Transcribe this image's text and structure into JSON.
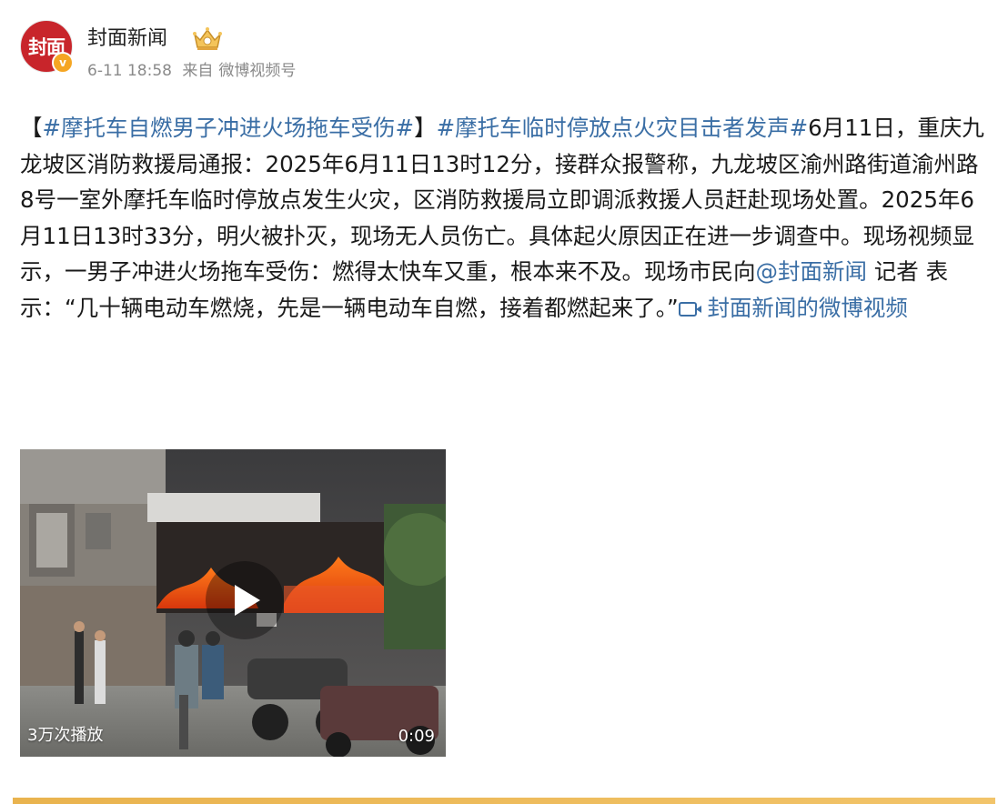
{
  "header": {
    "avatar_text": "封面",
    "avatar_badge": "v",
    "username": "封面新闻",
    "crown_icon": "crown-icon",
    "timestamp": "6-11 18:58",
    "source_prefix": "来自",
    "source": "微博视频号"
  },
  "post": {
    "bracket_open": "【",
    "topic_1": "#摩托车自燃男子冲进火场拖车受伤#",
    "bracket_close": "】",
    "topic_2": "#摩托车临时停放点火灾目击者发声#",
    "body_1": "6月11日，重庆九龙坡区消防救援局通报：2025年6月11日13时12分，接群众报警称，九龙坡区渝州路街道渝州路8号一室外摩托车临时停放点发生火灾，区消防救援局立即调派救援人员赶赴现场处置。2025年6月11日13时33分，明火被扑灭，现场无人员伤亡。具体起火原因正在进一步调查中。现场视频显示，一男子冲进火场拖车受伤：燃得太快车又重，根本来不及。现场市民向",
    "mention": "@封面新闻",
    "body_2": " 记者 表示：“几十辆电动车燃烧，先是一辆电动车自燃，接着都燃起来了。”",
    "video_link": "封面新闻的微博视频"
  },
  "video": {
    "view_count": "3万次播放",
    "duration": "0:09"
  },
  "colors": {
    "link": "#3a6ea5",
    "meta": "#8a8a8a",
    "avatar_bg": "#c8252b",
    "bottom_bar": "#e9b34e"
  }
}
